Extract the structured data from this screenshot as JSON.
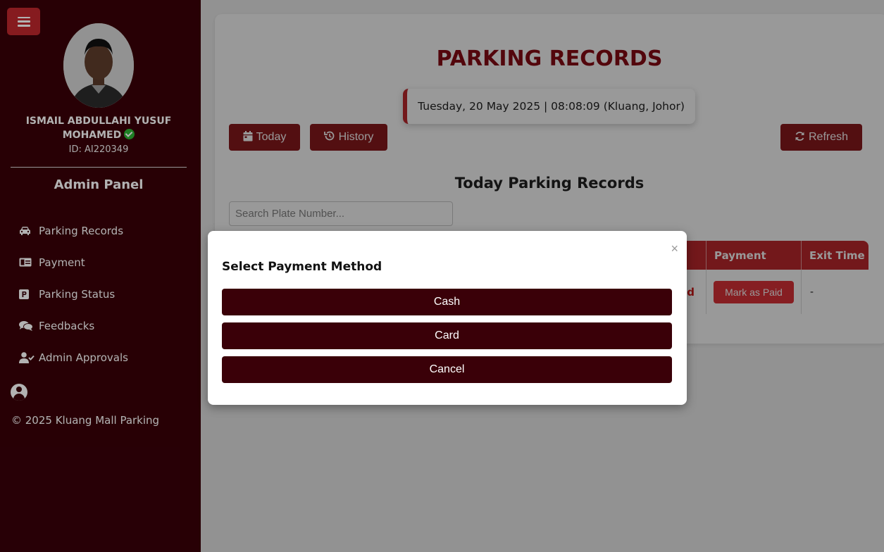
{
  "sidebar": {
    "user_name": "ISMAIL ABDULLAHI YUSUF MOHAMED",
    "user_id": "ID: AI220349",
    "panel_title": "Admin Panel",
    "nav": [
      {
        "label": "Parking Records",
        "icon": "car-icon"
      },
      {
        "label": "Payment",
        "icon": "money-bill-icon"
      },
      {
        "label": "Parking Status",
        "icon": "parking-icon"
      },
      {
        "label": "Feedbacks",
        "icon": "comments-icon"
      },
      {
        "label": "Admin Approvals",
        "icon": "user-check-icon"
      }
    ],
    "copyright": "© 2025 Kluang Mall Parking"
  },
  "main": {
    "title": "PARKING RECORDS",
    "datetime": "Tuesday, 20 May 2025 | 08:08:09 (Kluang, Johor)",
    "today_label": "Today",
    "history_label": "History",
    "refresh_label": "Refresh",
    "section_title": "Today Parking Records",
    "search_placeholder": "Search Plate Number...",
    "table": {
      "headers": {
        "payment": "Payment",
        "exit_time": "Exit Time"
      },
      "rows": [
        {
          "status_fragment": "d",
          "payment_action": "Mark as Paid",
          "exit_time": "-"
        }
      ]
    }
  },
  "modal": {
    "title": "Select Payment Method",
    "close": "×",
    "cash": "Cash",
    "card": "Card",
    "cancel": "Cancel"
  },
  "colors": {
    "sidebar_bg": "#3a0008",
    "accent": "#c0282d",
    "title_red": "#8b0a14",
    "button_dark": "#8b1a1d",
    "verified_green": "#2bb534"
  }
}
